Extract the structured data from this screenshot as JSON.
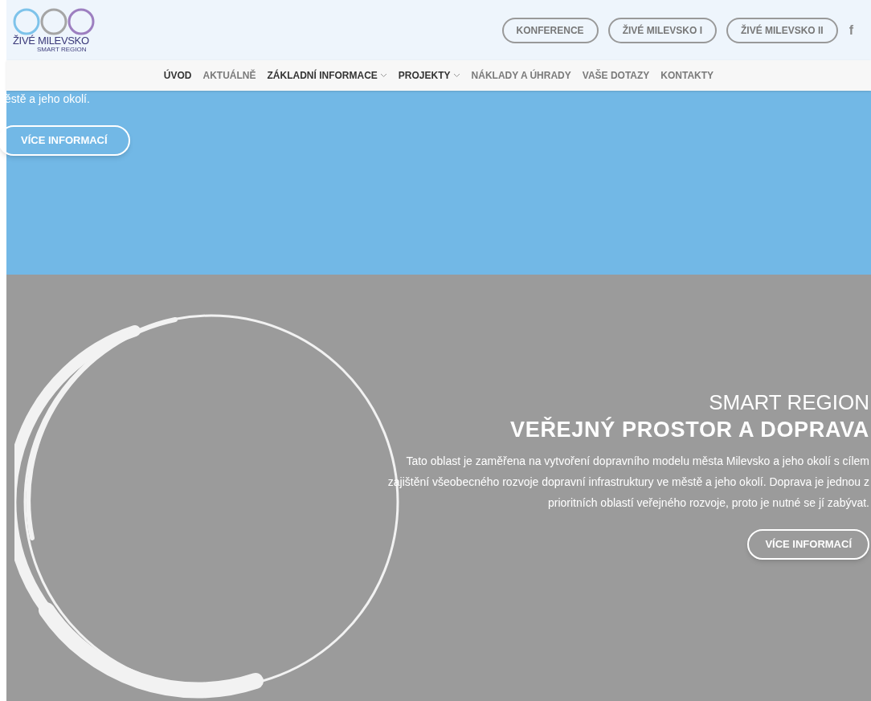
{
  "header": {
    "logo": {
      "title": "ŽIVÉ MILEVSKO",
      "subtitle": "SMART REGION"
    },
    "top_buttons": [
      "KONFERENCE",
      "ŽIVÉ MILEVSKO I",
      "ŽIVÉ MILEVSKO II"
    ],
    "social": "f",
    "nav": [
      {
        "label": "ÚVOD",
        "dark": true,
        "dropdown": false
      },
      {
        "label": "AKTUÁLNĚ",
        "dark": false,
        "dropdown": false
      },
      {
        "label": "ZÁKLADNÍ INFORMACE",
        "dark": true,
        "dropdown": true
      },
      {
        "label": "PROJEKTY",
        "dark": true,
        "dropdown": true
      },
      {
        "label": "NÁKLADY A ÚHRADY",
        "dark": false,
        "dropdown": false
      },
      {
        "label": "VAŠE DOTAZY",
        "dark": false,
        "dropdown": false
      },
      {
        "label": "KONTAKTY",
        "dark": false,
        "dropdown": false
      }
    ]
  },
  "hero_blue": {
    "text_tail": "ěstě a jeho okolí.",
    "button": "VÍCE INFORMACÍ"
  },
  "hero_gray": {
    "kicker": "SMART REGION",
    "title": "VEŘEJNÝ PROSTOR A DOPRAVA",
    "text": "Tato oblast je zaměřena na vytvoření dopravního modelu města Milevsko a jeho okolí s cílem zajištění všeobecného rozvoje dopravní infrastruktury ve městě a jeho okolí. Doprava je jednou z prioritních oblastí veřejného rozvoje, proto je nutné se jí zabývat.",
    "button": "VÍCE INFORMACÍ"
  }
}
